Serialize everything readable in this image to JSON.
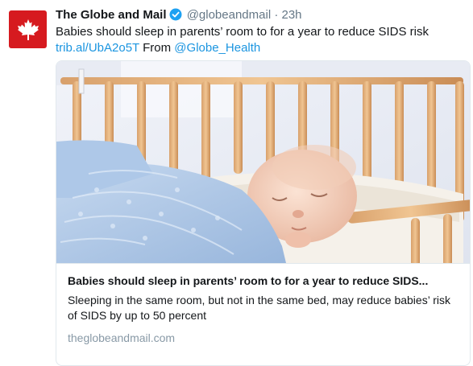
{
  "tweet": {
    "author_name": "The Globe and Mail",
    "handle": "@globeandmail",
    "separator": "·",
    "time": "23h",
    "text": "Babies should sleep in parents’ room to for a year to reduce SIDS risk",
    "short_link": "trib.al/UbA2o5T",
    "from_label": " From ",
    "from_handle": "@Globe_Health",
    "avatar_icon": "maple-leaf-icon",
    "verified_icon": "verified-badge-icon",
    "colors": {
      "brand": "#d61a1f",
      "link": "#1b95e0",
      "verified": "#1da1f2",
      "muted": "#657786"
    }
  },
  "card": {
    "title": "Babies should sleep in parents’ room to for a year to reduce SIDS...",
    "description": "Sleeping in the same room, but not in the same bed, may reduce babies’ risk of SIDS by up to 50 percent",
    "domain": "theglobeandmail.com"
  }
}
